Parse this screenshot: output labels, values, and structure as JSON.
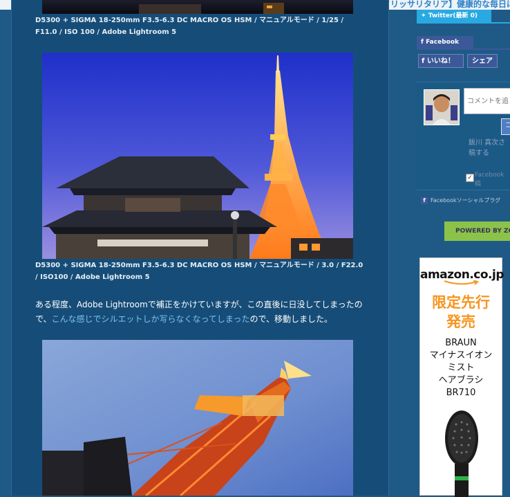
{
  "top_notice": {
    "text": "[PR]【与たけ牛額！】休息りボードリッサリタリア】健康的な毎日は"
  },
  "main": {
    "captions": [
      "D5300 + SIGMA 18-250mm F3.5-6.3 DC MACRO OS HSM / マニュアルモード / 1/25 / F11.0 / ISO 100 / Adobe Lightroom 5",
      "D5300 + SIGMA 18-250mm F3.5-6.3 DC MACRO OS HSM / マニュアルモード / 3.0 / F22.0 / ISO100 / Adobe Lightroom 5"
    ],
    "paragraph": {
      "before": "ある程度、Adobe Lightroomで補正をかけていますが、この直後に日没してしまったので、",
      "link": "こんな感じでシルエットしか写らなくなってしまった",
      "after": "ので、移動しました。"
    }
  },
  "sidebar": {
    "twitter_tab": "Twitter(最新 0)",
    "facebook_tab": "Facebook",
    "like_button": "いいね！",
    "share_button": "シェア",
    "comment_placeholder": "コメントを追",
    "post_button": "コ",
    "fb_user": "飯川 真次さ 稿する",
    "fb_post_label": "Facebook",
    "fb_post_label2": "稿",
    "fb_plugin": "Facebookソーシャルプラグ",
    "powered_by": "POWERED BY ZO",
    "ad": {
      "logo": "amazon.co.jp",
      "promo_line1": "限定先行",
      "promo_line2": "発売",
      "product_lines": [
        "BRAUN",
        "マイナスイオン",
        "ミスト",
        "ヘアブラシ",
        "BR710"
      ]
    }
  },
  "colors": {
    "page_bg": "#1f5a86",
    "content_bg": "#164d78",
    "twitter": "#29a9e1",
    "facebook": "#3b5998",
    "link": "#7cc3f2",
    "accent_green": "#8bc34a",
    "ad_orange": "#f7941e"
  }
}
